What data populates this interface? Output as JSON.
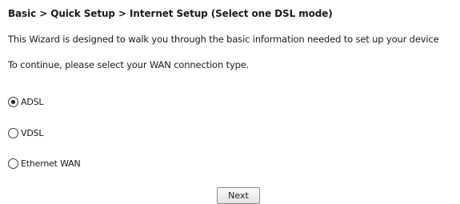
{
  "breadcrumb": "Basic > Quick Setup > Internet Setup (Select one DSL mode)",
  "intro_text": "This Wizard is designed to walk you through the basic information needed to set up your device",
  "instruction_text": "To continue, please select your WAN connection type.",
  "wan_options": [
    {
      "label": "ADSL",
      "selected": true
    },
    {
      "label": "VDSL",
      "selected": false
    },
    {
      "label": "Ethernet WAN",
      "selected": false
    }
  ],
  "next_button_label": "Next"
}
